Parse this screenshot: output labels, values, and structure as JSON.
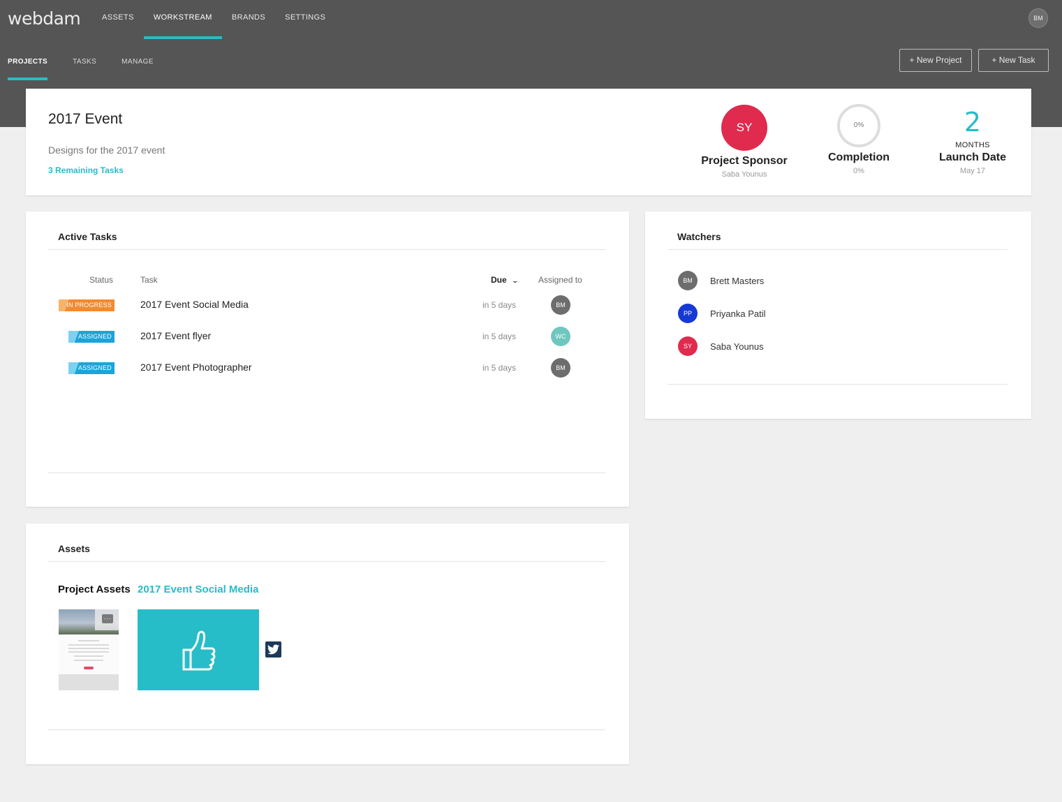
{
  "app": {
    "logo": "webdam"
  },
  "nav": {
    "items": [
      {
        "label": "ASSETS"
      },
      {
        "label": "WORKSTREAM"
      },
      {
        "label": "BRANDS"
      },
      {
        "label": "SETTINGS"
      }
    ],
    "active": "WORKSTREAM",
    "user_initials": "BM"
  },
  "subnav": {
    "items": [
      {
        "label": "PROJECTS"
      },
      {
        "label": "TASKS"
      },
      {
        "label": "MANAGE"
      }
    ],
    "active": "PROJECTS"
  },
  "actions": {
    "new_project": "+ New Project",
    "new_task": "+ New Task"
  },
  "project": {
    "title": "2017 Event",
    "description": "Designs for the 2017 event",
    "remaining": "3 Remaining Tasks",
    "sponsor": {
      "initials": "SY",
      "label": "Project Sponsor",
      "name": "Saba Younus",
      "color": "#e02a4e"
    },
    "completion": {
      "ring_text": "0%",
      "label": "Completion",
      "value": "0%"
    },
    "launch": {
      "number": "2",
      "unit": "MONTHS",
      "label": "Launch Date",
      "date": "May 17"
    }
  },
  "active_tasks": {
    "title": "Active Tasks",
    "columns": {
      "status": "Status",
      "task": "Task",
      "due": "Due",
      "assigned": "Assigned to"
    },
    "rows": [
      {
        "status": "IN PROGRESS",
        "task": "2017 Event Social Media",
        "due": "in 5 days",
        "assignee": "BM",
        "assignee_color": "#6d6d6d"
      },
      {
        "status": "ASSIGNED",
        "task": "2017 Event flyer",
        "due": "in 5 days",
        "assignee": "WC",
        "assignee_color": "#6fc7bf"
      },
      {
        "status": "ASSIGNED",
        "task": "2017 Event Photographer",
        "due": "in 5 days",
        "assignee": "BM",
        "assignee_color": "#6d6d6d"
      }
    ]
  },
  "watchers": {
    "title": "Watchers",
    "items": [
      {
        "initials": "BM",
        "name": "Brett Masters",
        "color": "#6d6d6d"
      },
      {
        "initials": "PP",
        "name": "Priyanka Patil",
        "color": "#1639d4"
      },
      {
        "initials": "SY",
        "name": "Saba Younus",
        "color": "#e02a4e"
      }
    ]
  },
  "assets": {
    "title": "Assets",
    "project_assets_label": "Project Assets",
    "linked_task": "2017 Event Social Media"
  },
  "colors": {
    "accent": "#26bdc9",
    "topbar": "#555555",
    "in_progress": "#f28a2e",
    "assigned": "#1ba4d9"
  }
}
